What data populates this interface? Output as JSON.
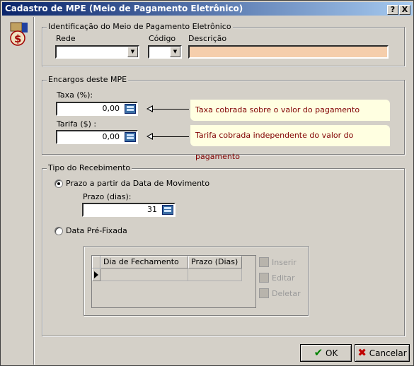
{
  "window": {
    "title": "Cadastro de MPE (Meio de Pagamento Eletrônico)",
    "help_label": "?",
    "close_label": "X"
  },
  "identificacao": {
    "group_title": "Identificação do Meio de Pagamento Eletrônico",
    "rede_label": "Rede",
    "codigo_label": "Código",
    "descricao_label": "Descrição"
  },
  "encargos": {
    "group_title": "Encargos deste MPE",
    "taxa_label": "Taxa (%):",
    "taxa_value": "0,00",
    "taxa_hint": "Taxa cobrada sobre o valor do pagamento",
    "tarifa_label": "Tarifa ($) :",
    "tarifa_value": "0,00",
    "tarifa_hint": "Tarifa cobrada independente do valor do pagamento"
  },
  "recebimento": {
    "group_title": "Tipo do Recebimento",
    "option_prazo": "Prazo a partir da Data de Movimento",
    "prazo_label": "Prazo (dias):",
    "prazo_value": "31",
    "option_prefixada": "Data Pré-Fixada",
    "grid_columns": [
      "Dia de Fechamento",
      "Prazo (Dias)"
    ],
    "inserir_label": "Inserir",
    "editar_label": "Editar",
    "deletar_label": "Deletar"
  },
  "buttons": {
    "ok_label": "OK",
    "cancel_label": "Cancelar"
  },
  "colors": {
    "descricao_bg": "#f5ceac",
    "hint_bg": "#ffffe1",
    "hint_text": "#800000",
    "ok_check": "#008000",
    "cancel_x": "#c00000"
  }
}
